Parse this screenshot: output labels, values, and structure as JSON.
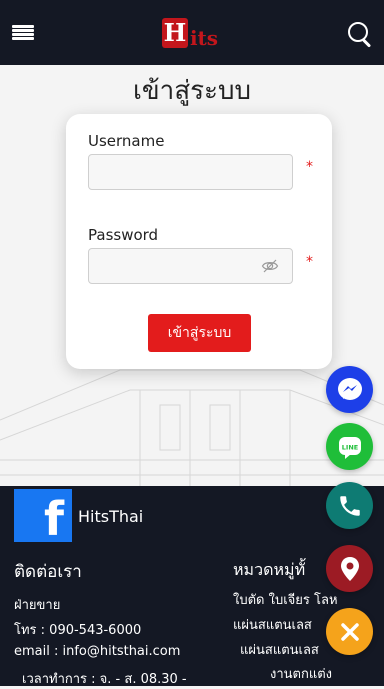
{
  "header": {
    "logo_mark": "H",
    "logo_text": "its"
  },
  "page": {
    "title": "เข้าสู่ระบบ"
  },
  "login_form": {
    "username_label": "Username",
    "username_value": "",
    "password_label": "Password",
    "password_value": "",
    "required_mark": "*",
    "submit_label": "เข้าสู่ระบบ"
  },
  "footer": {
    "facebook_glyph": "f",
    "facebook_name": "HitsThai",
    "contact": {
      "title": "ติดต่อเรา",
      "sales": "ฝ่ายขาย",
      "phone": "โทร : 090-543-6000",
      "email": "email : info@hitsthai.com",
      "hours": "เวลาทำการ : จ. - ส. 08.30 -"
    },
    "categories": {
      "title": "หมวดหมู่ทั้",
      "items": [
        "ใบตัด ใบเจียร โลห",
        "แผ่นสแตนเลส",
        "แผ่นสแตนเลส",
        "งานตกแต่ง"
      ]
    }
  },
  "floating_buttons": {
    "colors": {
      "messenger": "#1d3fe8",
      "line": "#1fbe39",
      "phone": "#0e7b73",
      "location": "#9c1b24",
      "close": "#f5a31b"
    },
    "icons": [
      "messenger-icon",
      "line-icon",
      "phone-icon",
      "map-pin-icon",
      "close-icon"
    ]
  }
}
